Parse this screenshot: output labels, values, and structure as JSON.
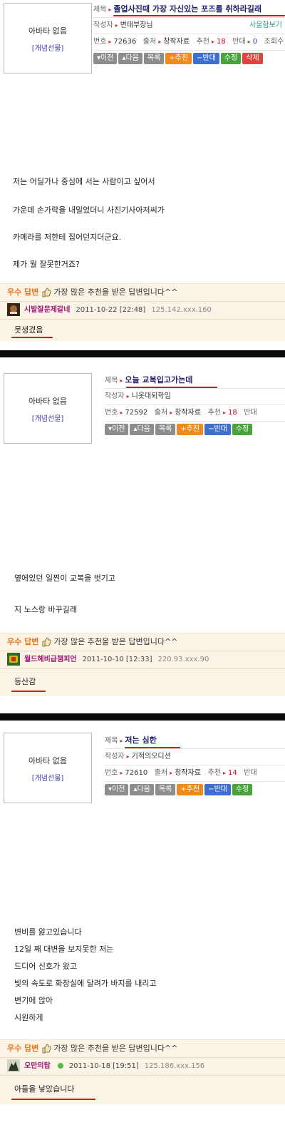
{
  "common": {
    "avatar_none": "아바타 없음",
    "gift": "[개념선물]",
    "label_title": "제목",
    "label_author": "작성자",
    "label_no": "번호",
    "label_source": "출처",
    "source": "창작자료",
    "label_rec": "추천",
    "label_opp": "반대",
    "label_views": "조회수",
    "send_message": "사물함보기",
    "btn_prev": "이전",
    "btn_next": "다음",
    "btn_list": "목록",
    "btn_rec": "추천",
    "btn_opp": "반대",
    "btn_edit": "수정",
    "btn_delete": "삭제",
    "best_label": "우수 답변",
    "best_text": "가장 많은 추천을 받은 답변입니다^^"
  },
  "posts": [
    {
      "title": "졸업사진때 가장 자신있는 포즈를 취하라길래",
      "author": "변태부장님",
      "no": "72636",
      "rec": "18",
      "opp": "0",
      "lines": [
        "저는 어딜가나 중심에 서는 사람이고 싶어서",
        "가운데 손가락을 내밀었더니 사진기사아저씨가",
        "카메라를 저한테 집어던지더군요.",
        "제가 뭘 잘못한거죠?"
      ],
      "answer": {
        "nick": "시발잘문제같네",
        "date": "2011-10-22 [22:48]",
        "ip": "125.142.xxx.160",
        "text": "못생겼음"
      }
    },
    {
      "title": "오늘 교복입고가는데",
      "author": "니옷대퇴학임",
      "no": "72592",
      "rec": "18",
      "opp": "",
      "lines": [
        "옆에있던 일찐이 교복을 벗기고",
        "지 노스랑 바꾸길래"
      ],
      "answer": {
        "nick": "월드헤비급챔피언",
        "date": "2011-10-10 [12:33]",
        "ip": "220.93.xxx.90",
        "text": "등산감"
      }
    },
    {
      "title": "저는 심한",
      "author": "기적의오디션",
      "no": "72610",
      "rec": "14",
      "opp": "",
      "lines": [
        "변비를 앓고있습니다",
        "12일 째 대변을 보지못한 저는",
        "드디어 신호가 왔고",
        "빛의 속도로 화장실에 달려가 바지를 내리고",
        "변기에 앉아",
        "시원하게"
      ],
      "answer": {
        "nick": "오만의탑",
        "date": "2011-10-18 [19:51]",
        "ip": "125.186.xxx.156",
        "text": "아들을 낳았습니다"
      }
    }
  ]
}
